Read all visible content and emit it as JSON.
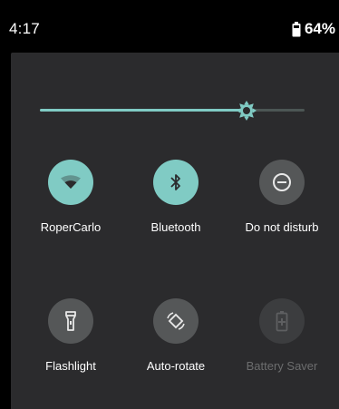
{
  "status_bar": {
    "time": "4:17",
    "battery_percent": "64%",
    "battery_icon": "battery-icon"
  },
  "brightness": {
    "level_fraction": 0.78,
    "icon": "brightness-icon"
  },
  "tiles": [
    {
      "label": "RoperCarlo",
      "icon": "wifi-icon",
      "state": "active"
    },
    {
      "label": "Bluetooth",
      "icon": "bluetooth-icon",
      "state": "active"
    },
    {
      "label": "Do not disturb",
      "icon": "do-not-disturb-icon",
      "state": "inactive"
    },
    {
      "label": "Flashlight",
      "icon": "flashlight-icon",
      "state": "inactive"
    },
    {
      "label": "Auto-rotate",
      "icon": "auto-rotate-icon",
      "state": "inactive"
    },
    {
      "label": "Battery Saver",
      "icon": "battery-saver-icon",
      "state": "disabled"
    }
  ],
  "colors": {
    "accent": "#80cbc4",
    "panel_background": "#2b2b2d",
    "inactive_tile": "#555758",
    "disabled_tile": "#3c3d3f"
  }
}
